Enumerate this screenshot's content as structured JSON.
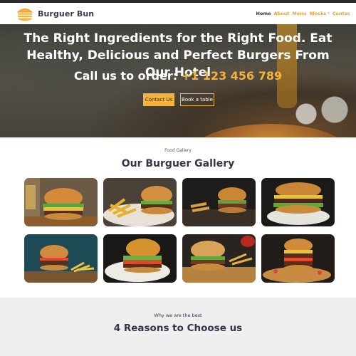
{
  "brand": {
    "name": "Burguer Bun",
    "icon": "burger-logo-icon",
    "accent": "#f3b33d"
  },
  "nav": {
    "items": [
      {
        "label": "Home",
        "active": true
      },
      {
        "label": "About",
        "active": false
      },
      {
        "label": "Menu",
        "active": false
      },
      {
        "label": "Blocks",
        "active": false,
        "dropdown": true
      },
      {
        "label": "Contac",
        "active": false
      }
    ]
  },
  "hero": {
    "title": "The Right Ingredients for the Right Food. Eat Healthy, Delicious and Perfect Burgers From Our Hotel",
    "phone_prefix": "Call us to order: ",
    "phone": "+1 123 456 789",
    "primary_button": "Contact Us",
    "secondary_button": "Book a table"
  },
  "gallery": {
    "subtitle": "Food Gallery",
    "title": "Our Burguer Gallery",
    "photos": [
      "burger-photo",
      "burger-fries-photo",
      "burger-fries-photo",
      "burger-photo",
      "burger-fries-photo",
      "burger-photo",
      "burger-fries-photo",
      "burger-photo"
    ]
  },
  "reasons": {
    "subtitle": "Why we are the best",
    "title": "4 Reasons to Choose us"
  }
}
